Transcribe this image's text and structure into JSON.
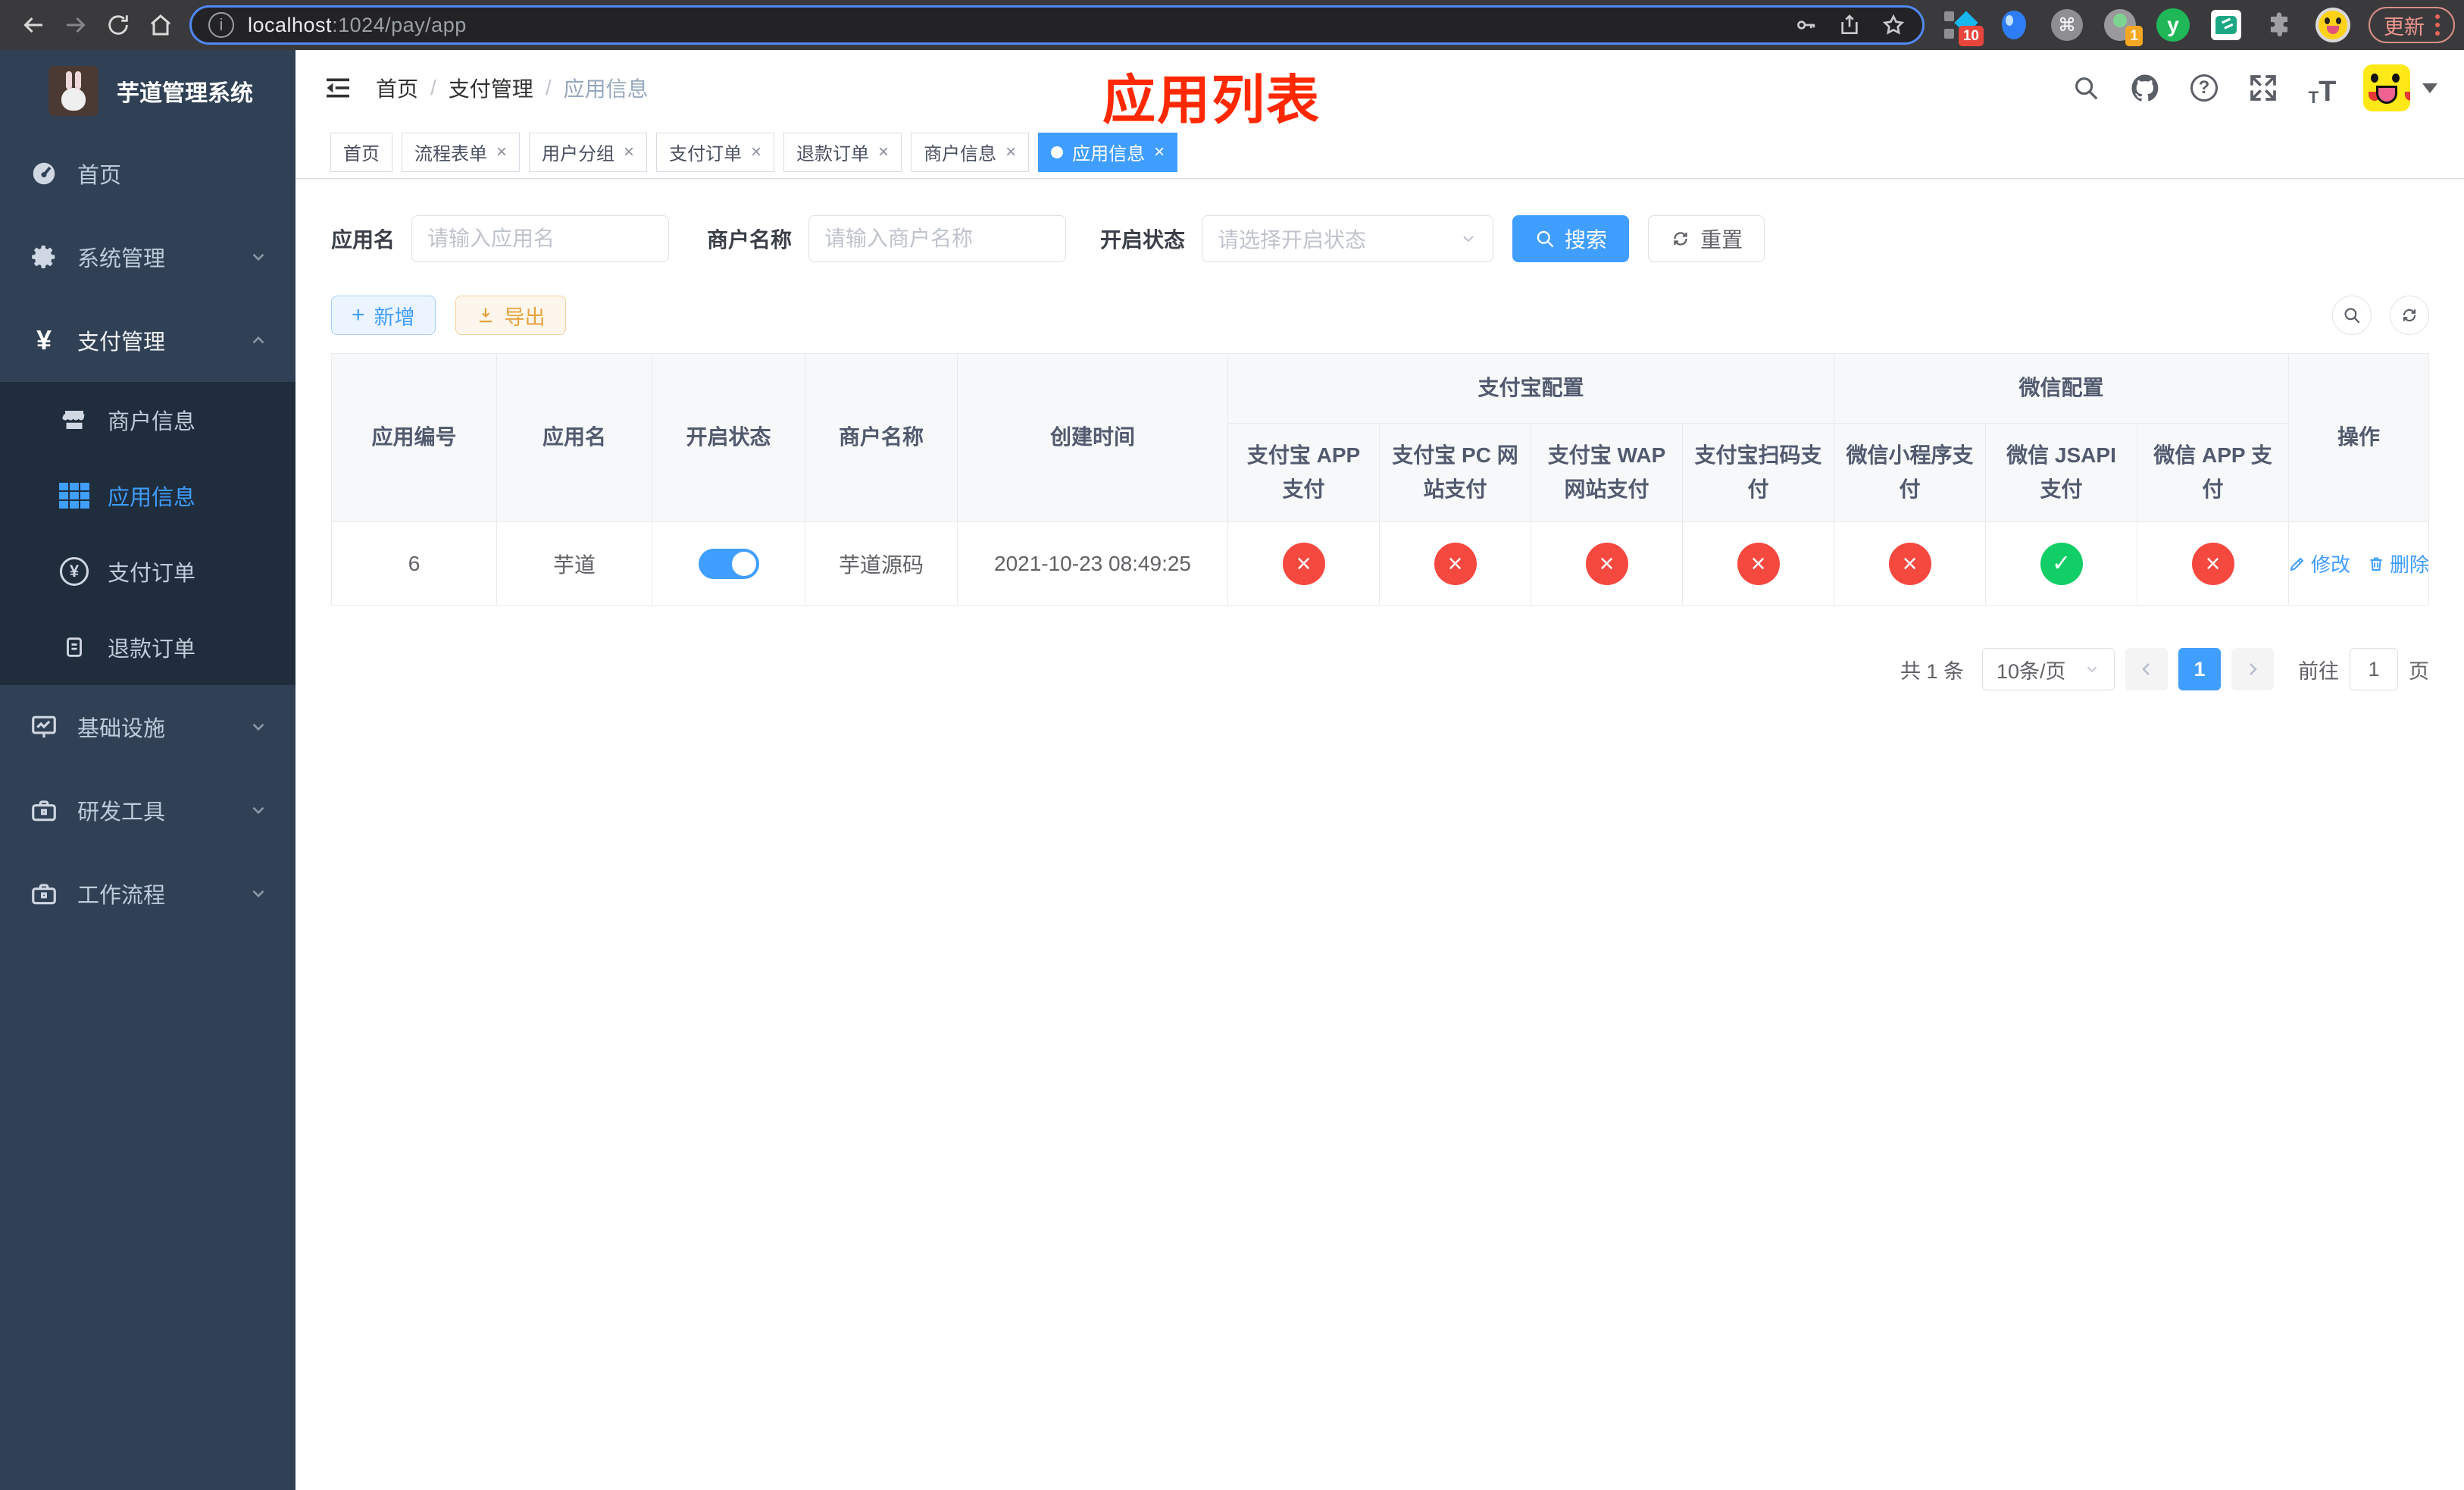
{
  "browser": {
    "url_host": "localhost",
    "url_rest": ":1024/pay/app",
    "update_label": "更新",
    "badge_10": "10",
    "badge_1": "1"
  },
  "icons": {
    "info": "ⓘ",
    "close": "×",
    "plus": "+",
    "yuan": "¥",
    "question": "?",
    "command": "⌘",
    "y_letter": "y",
    "font_small": "T",
    "font_big": "T"
  },
  "sidebar": {
    "title": "芋道管理系统",
    "items": [
      {
        "label": "首页"
      },
      {
        "label": "系统管理"
      },
      {
        "label": "支付管理"
      },
      {
        "label": "商户信息"
      },
      {
        "label": "应用信息"
      },
      {
        "label": "支付订单"
      },
      {
        "label": "退款订单"
      },
      {
        "label": "基础设施"
      },
      {
        "label": "研发工具"
      },
      {
        "label": "工作流程"
      }
    ]
  },
  "breadcrumb": {
    "home": "首页",
    "section": "支付管理",
    "current": "应用信息"
  },
  "overlay_title": "应用列表",
  "tabs": [
    {
      "label": "首页"
    },
    {
      "label": "流程表单"
    },
    {
      "label": "用户分组"
    },
    {
      "label": "支付订单"
    },
    {
      "label": "退款订单"
    },
    {
      "label": "商户信息"
    },
    {
      "label": "应用信息"
    }
  ],
  "filters": {
    "app_name_label": "应用名",
    "app_name_placeholder": "请输入应用名",
    "merchant_label": "商户名称",
    "merchant_placeholder": "请输入商户名称",
    "status_label": "开启状态",
    "status_placeholder": "请选择开启状态",
    "search_label": "搜索",
    "reset_label": "重置"
  },
  "toolbar": {
    "add_label": "新增",
    "export_label": "导出"
  },
  "table": {
    "headers": {
      "app_id": "应用编号",
      "app_name": "应用名",
      "open_status": "开启状态",
      "merchant_name": "商户名称",
      "create_time": "创建时间",
      "alipay_group": "支付宝配置",
      "wechat_group": "微信配置",
      "action": "操作",
      "alipay_cols": [
        "支付宝 APP 支付",
        "支付宝 PC 网站支付",
        "支付宝 WAP 网站支付",
        "支付宝扫码支付"
      ],
      "wechat_cols": [
        "微信小程序支付",
        "微信 JSAPI 支付",
        "微信 APP 支付"
      ]
    },
    "row": {
      "app_id": "6",
      "app_name": "芋道",
      "enabled": true,
      "merchant_name": "芋道源码",
      "create_time": "2021-10-23 08:49:25",
      "statuses": [
        "no",
        "no",
        "no",
        "no",
        "no",
        "yes",
        "no"
      ],
      "edit_label": "修改",
      "delete_label": "删除"
    }
  },
  "pagination": {
    "total": "共 1 条",
    "page_size": "10条/页",
    "current_page": "1",
    "goto_label": "前往",
    "goto_value": "1",
    "page_suffix": "页"
  },
  "colors": {
    "accent": "#409eff",
    "danger": "#f5483f",
    "success": "#12ce66",
    "warning": "#e6a23c",
    "sidebar_bg": "#304156",
    "submenu_bg": "#1f2d3d",
    "overlay_title_red": "#ff2800"
  }
}
